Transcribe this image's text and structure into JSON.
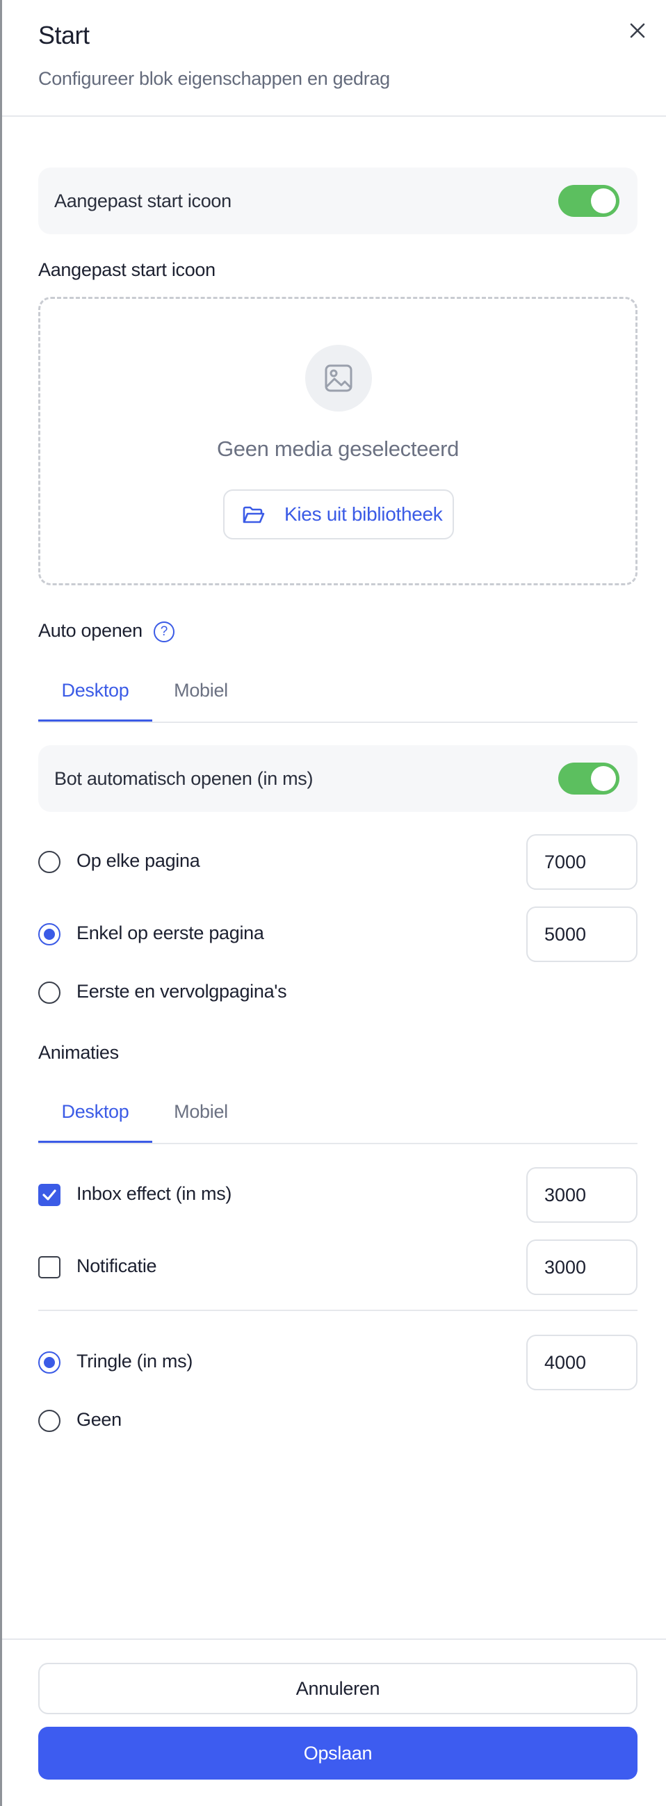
{
  "header": {
    "title": "Start",
    "subtitle": "Configureer blok eigenschappen en gedrag",
    "close_icon": "close-icon"
  },
  "custom_icon": {
    "toggle_label": "Aangepast start icoon",
    "toggle_on": true,
    "section_label": "Aangepast start icoon",
    "media_icon": "image-icon",
    "no_media_text": "Geen media geselecteerd",
    "pick_button_label": "Kies uit bibliotheek",
    "pick_button_icon": "folder-open-icon"
  },
  "auto_open": {
    "label": "Auto openen",
    "help_icon": "?",
    "tabs": [
      {
        "label": "Desktop",
        "active": true
      },
      {
        "label": "Mobiel",
        "active": false
      }
    ],
    "toggle_label": "Bot automatisch openen (in ms)",
    "toggle_on": true,
    "options": [
      {
        "label": "Op elke pagina",
        "selected": false,
        "value": "7000"
      },
      {
        "label": "Enkel op eerste pagina",
        "selected": true,
        "value": "5000"
      },
      {
        "label": "Eerste en vervolgpagina's",
        "selected": false
      }
    ]
  },
  "animations": {
    "label": "Animaties",
    "tabs": [
      {
        "label": "Desktop",
        "active": true
      },
      {
        "label": "Mobiel",
        "active": false
      }
    ],
    "checks": [
      {
        "label": "Inbox effect (in ms)",
        "checked": true,
        "value": "3000"
      },
      {
        "label": "Notificatie",
        "checked": false,
        "value": "3000"
      }
    ],
    "radios": [
      {
        "label": "Tringle (in ms)",
        "selected": true,
        "value": "4000"
      },
      {
        "label": "Geen",
        "selected": false
      }
    ]
  },
  "footer": {
    "cancel_label": "Annuleren",
    "save_label": "Opslaan"
  },
  "colors": {
    "accent": "#3d5cf0",
    "toggle_on": "#5cbf5f",
    "row_background": "#f6f7f9"
  }
}
